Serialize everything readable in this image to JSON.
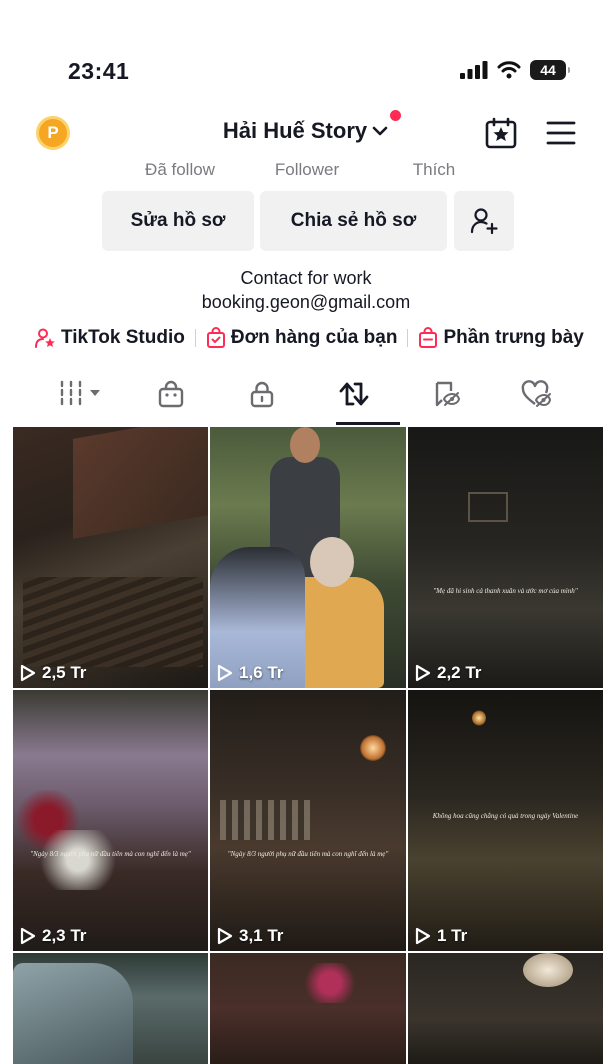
{
  "status_bar": {
    "time": "23:41",
    "battery": "44"
  },
  "header": {
    "coin_letter": "P",
    "username": "Hải Huế Story"
  },
  "stats": {
    "following_label": "Đã follow",
    "followers_label": "Follower",
    "likes_label": "Thích"
  },
  "buttons": {
    "edit_profile": "Sửa hồ sơ",
    "share_profile": "Chia sẻ hồ sơ"
  },
  "bio": {
    "line1": "Contact for work",
    "line2": "booking.geon@gmail.com"
  },
  "links": [
    {
      "label": "TikTok Studio"
    },
    {
      "label": "Đơn hàng của bạn"
    },
    {
      "label": "Phần trưng bày"
    }
  ],
  "tabs": [
    "grid",
    "shop",
    "private",
    "reposts",
    "favorites",
    "liked"
  ],
  "active_tab": "reposts",
  "videos": [
    {
      "views": "2,5 Tr"
    },
    {
      "views": "1,6 Tr"
    },
    {
      "views": "2,2 Tr",
      "caption": "\"Mẹ đã hi sinh cả thanh xuân và ước mơ của mình\""
    },
    {
      "views": "2,3 Tr",
      "caption": "\"Ngày 8/3 người phụ nữ đầu tiên mà con nghĩ đến là mẹ\""
    },
    {
      "views": "3,1 Tr",
      "caption": "\"Ngày 8/3 người phụ nữ đầu tiên mà con nghĩ đến là mẹ\""
    },
    {
      "views": "1 Tr",
      "caption": "Không hoa cũng chẳng có quà trong ngày Valentine"
    },
    {
      "views": ""
    },
    {
      "views": ""
    },
    {
      "views": ""
    }
  ],
  "colors": {
    "accent": "#fe2c55",
    "coin": "#f5a623",
    "button_bg": "#f1f1f2"
  }
}
